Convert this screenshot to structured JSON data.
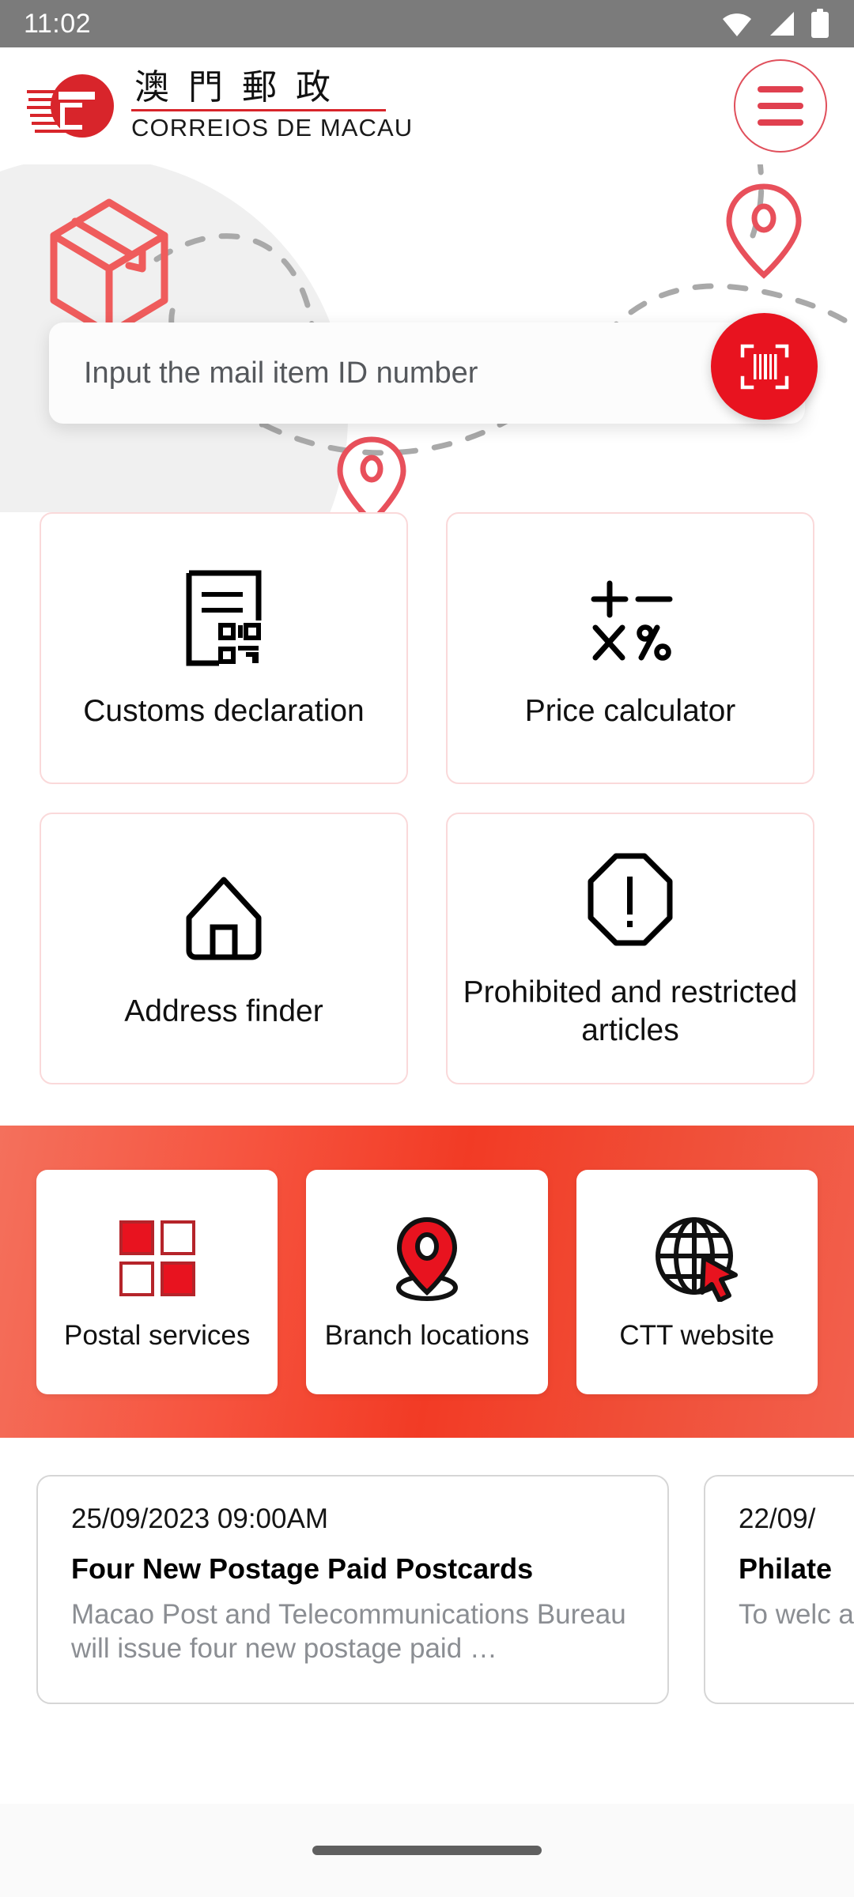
{
  "status_bar": {
    "time": "11:02",
    "icons": [
      "wifi-icon",
      "cellular-signal-icon",
      "battery-icon"
    ]
  },
  "header": {
    "logo_chinese": "澳門郵政",
    "logo_portuguese": "CORREIOS DE MACAU",
    "menu_label": "menu",
    "brand_red": "#d8252b",
    "menu_icon": "hamburger-menu-icon"
  },
  "hero": {
    "package_icon": "package-box-icon",
    "pin_icon_top": "map-pin-icon",
    "pin_icon_bottom": "map-pin-icon",
    "route_icon": "dashed-route-path"
  },
  "search": {
    "value": "",
    "placeholder": "Input the mail item ID number",
    "scan_icon": "barcode-scan-icon",
    "scan_button_color": "#e8131f"
  },
  "tiles": [
    {
      "label": "Customs declaration",
      "icon": "customs-document-qr-icon"
    },
    {
      "label": "Price calculator",
      "icon": "calculator-operators-icon"
    },
    {
      "label": "Address finder",
      "icon": "house-icon"
    },
    {
      "label": "Prohibited and restricted articles",
      "icon": "octagon-exclamation-icon"
    }
  ],
  "band": {
    "gradient_start": "#f4705c",
    "gradient_mid": "#f23b25",
    "gradient_end": "#f2604d",
    "tiles": [
      {
        "label": "Postal services",
        "icon": "four-squares-grid-icon"
      },
      {
        "label": "Branch locations",
        "icon": "location-pin-base-icon"
      },
      {
        "label": "CTT website",
        "icon": "globe-cursor-icon"
      }
    ]
  },
  "news": {
    "items": [
      {
        "date": "25/09/2023 09:00AM",
        "title": "Four New Postage Paid Postcards",
        "body": "Macao Post and Telecommunications Bureau will issue four new postage paid …"
      },
      {
        "date": "22/09/",
        "title": "Philate",
        "body": "To welc and Nat"
      }
    ]
  },
  "navigation_bar": {
    "gesture_pill": "home-gesture-pill"
  }
}
